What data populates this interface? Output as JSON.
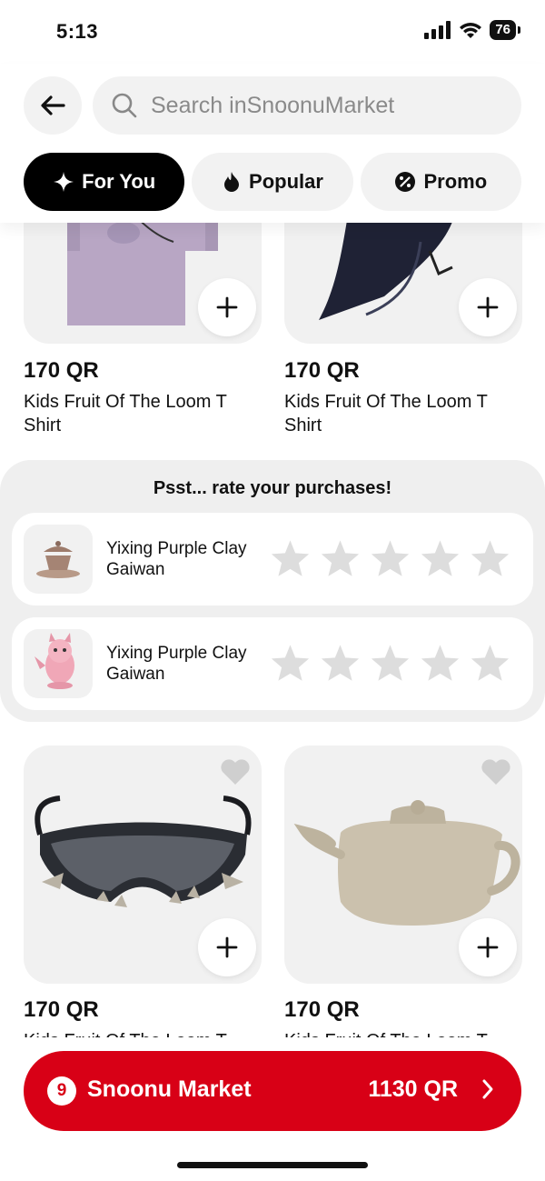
{
  "status_bar": {
    "time": "5:13",
    "battery": "76"
  },
  "header": {
    "search_placeholder": "Search inSnoonuMarket",
    "tabs": [
      {
        "label": "For You",
        "active": true,
        "icon": "sparkle-icon"
      },
      {
        "label": "Popular",
        "active": false,
        "icon": "flame-icon"
      },
      {
        "label": "Promo",
        "active": false,
        "icon": "percent-icon"
      }
    ]
  },
  "products_top": [
    {
      "price": "170 QR",
      "name": "Kids Fruit Of The Loom T Shirt",
      "image": "tshirt-image"
    },
    {
      "price": "170 QR",
      "name": "Kids Fruit Of The Loom T Shirt",
      "image": "bird-image"
    }
  ],
  "rate_panel": {
    "title": "Psst... rate your purchases!",
    "items": [
      {
        "name": "Yixing Purple Clay Gaiwan",
        "rating": 0,
        "max_rating": 5,
        "image": "gaiwan-image"
      },
      {
        "name": "Yixing Purple Clay Gaiwan",
        "rating": 0,
        "max_rating": 5,
        "image": "pink-figure-image"
      }
    ]
  },
  "products_bottom": [
    {
      "price": "170 QR",
      "name": "Kids Fruit Of The Loom T",
      "image": "sunglasses-image"
    },
    {
      "price": "170 QR",
      "name": "Kids Fruit Of The Loom T",
      "image": "teapot-image"
    }
  ],
  "cart_bar": {
    "count": "9",
    "label": "Snoonu Market",
    "total": "1130 QR"
  },
  "colors": {
    "brand_red": "#d80016",
    "star_gray": "#dddddd",
    "surface": "#f2f2f2"
  }
}
